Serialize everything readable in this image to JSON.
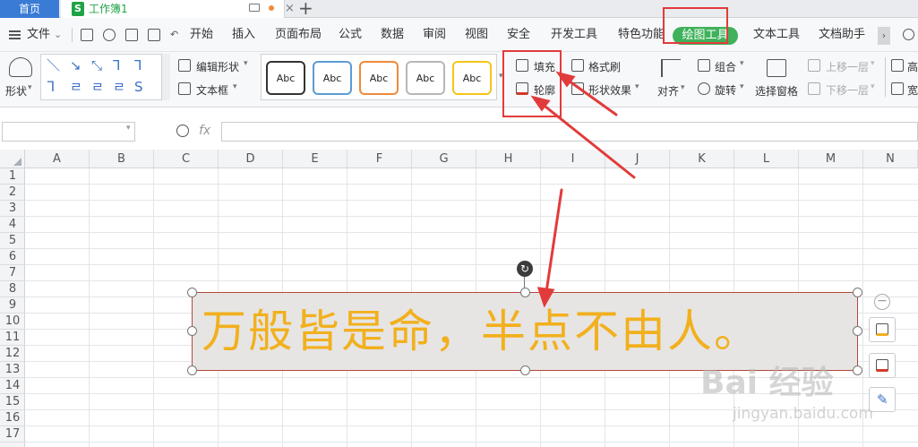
{
  "tabs": {
    "home": "首页",
    "doc_icon": "S",
    "doc_title": "工作簿1",
    "add": "+",
    "close": "×"
  },
  "menu": {
    "file": "文件",
    "items": [
      "开始",
      "插入",
      "页面布局",
      "公式",
      "数据",
      "审阅",
      "视图",
      "安全",
      "开发工具",
      "特色功能",
      "绘图工具",
      "文本工具",
      "文档助手"
    ],
    "active": "绘图工具",
    "more": "›"
  },
  "ribbon": {
    "shapes_label": "形状",
    "edit_shape": "编辑形状",
    "text_box": "文本框",
    "style_label": "Abc",
    "fill": "填充",
    "outline": "轮廓",
    "format_painter": "格式刷",
    "shape_effects": "形状效果",
    "align": "对齐",
    "group": "组合",
    "rotate": "旋转",
    "selection_pane": "选择窗格",
    "bring_forward": "上移一层",
    "send_backward": "下移一层",
    "height_cut": "高",
    "width_cut": "宽"
  },
  "formula_bar": {
    "fx": "fx"
  },
  "columns": [
    "A",
    "B",
    "C",
    "D",
    "E",
    "F",
    "G",
    "H",
    "I",
    "J",
    "K",
    "L",
    "M",
    "N"
  ],
  "rows": [
    "1",
    "2",
    "3",
    "4",
    "5",
    "6",
    "7",
    "8",
    "9",
    "10",
    "11",
    "12",
    "13",
    "14",
    "15",
    "16",
    "17"
  ],
  "shape": {
    "text": "万般皆是命，半点不由人。",
    "text_color": "#f2b01e",
    "fill_color": "#e6e5e4",
    "outline_color": "#b24a3a"
  },
  "watermark": {
    "main": "Bai 经验",
    "url": "jingyan.baidu.com"
  },
  "colors": {
    "accent": "#3fb15a",
    "home_tab": "#3a7bd5",
    "annotation": "#e23b3b"
  }
}
